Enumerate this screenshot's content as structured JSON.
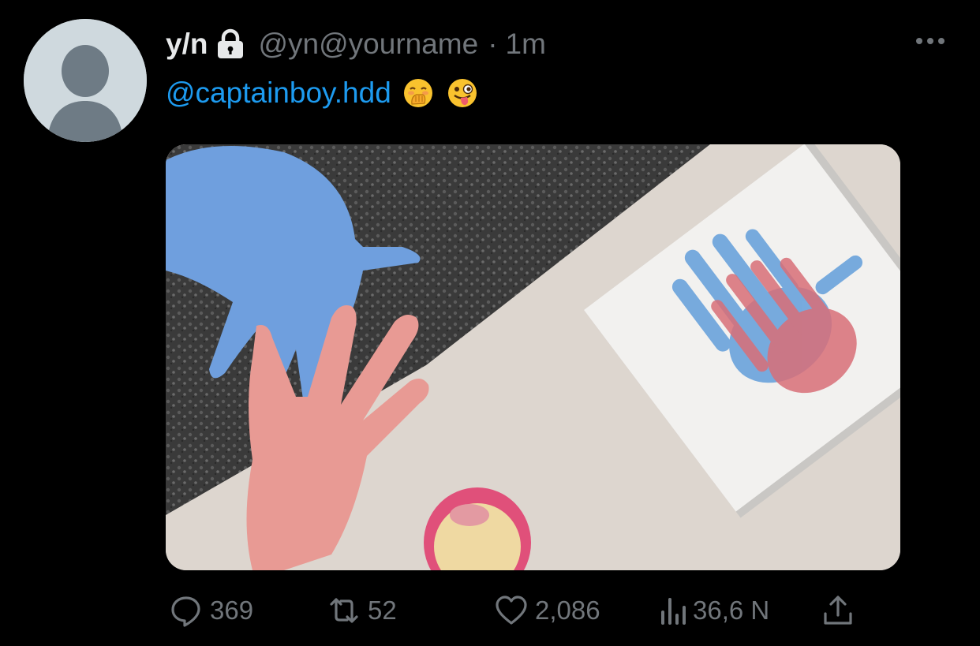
{
  "tweet": {
    "display_name": "y/n",
    "handle": "@yn@yourname",
    "separator": "·",
    "time": "1m",
    "text_mention": "@captainboy.hdd",
    "emojis": [
      "hand-over-mouth-emoji",
      "winking-tongue-emoji"
    ],
    "media_alt": "",
    "more_icon": "more-icon"
  },
  "actions": {
    "reply": {
      "icon": "reply-icon",
      "count": "369"
    },
    "retweet": {
      "icon": "retweet-icon",
      "count": "52"
    },
    "like": {
      "icon": "heart-icon",
      "count": "2,086"
    },
    "views": {
      "icon": "views-icon",
      "count": "36,6 N"
    },
    "share": {
      "icon": "share-icon"
    }
  },
  "colors": {
    "background": "#000000",
    "text_primary": "#e7e9ea",
    "text_secondary": "#71767b",
    "link": "#1d9bf0",
    "avatar_bg": "#cfd9de",
    "avatar_silhouette": "#6e7b85"
  }
}
